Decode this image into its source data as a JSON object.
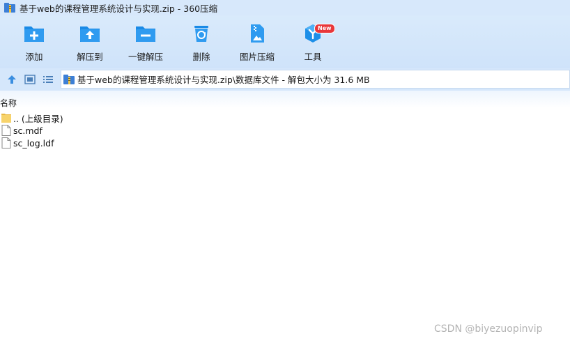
{
  "window": {
    "title": "基于web的课程管理系统设计与实现.zip - 360压缩",
    "app_icon": "archive-icon"
  },
  "toolbar": {
    "items": [
      {
        "label": "添加",
        "icon": "add-icon"
      },
      {
        "label": "解压到",
        "icon": "extract-to-icon"
      },
      {
        "label": "一键解压",
        "icon": "one-click-extract-icon"
      },
      {
        "label": "删除",
        "icon": "delete-icon"
      },
      {
        "label": "图片压缩",
        "icon": "image-compress-icon"
      },
      {
        "label": "工具",
        "icon": "tools-icon"
      }
    ],
    "tools_badge": "New"
  },
  "nav": {
    "path": "基于web的课程管理系统设计与实现.zip\\数据库文件 - 解包大小为 31.6 MB"
  },
  "list": {
    "column_name": "名称",
    "items": [
      {
        "name": ".. (上级目录)",
        "type": "folder"
      },
      {
        "name": "sc.mdf",
        "type": "file"
      },
      {
        "name": "sc_log.ldf",
        "type": "file"
      }
    ]
  },
  "watermark": "CSDN @biyezuopinvip",
  "colors": {
    "toolbar_bg": "#d3e6fb",
    "icon_blue": "#1a8ae6",
    "badge_red": "#e8373a",
    "folder_yellow": "#f7d36b"
  }
}
